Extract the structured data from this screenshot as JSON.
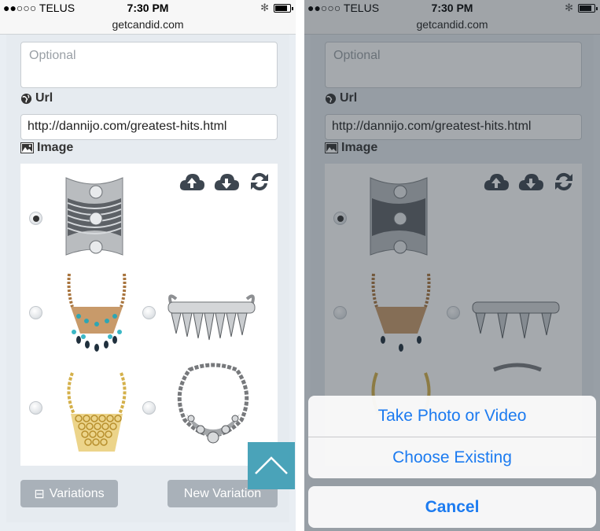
{
  "status": {
    "carrier": "●●○○○ TELUS",
    "time": "7:30 PM",
    "bluetooth": "✻",
    "domain": "getcandid.com"
  },
  "form": {
    "notes_placeholder": "Optional",
    "url_label": "Url",
    "url_value": "http://dannijo.com/greatest-hits.html",
    "image_label": "Image",
    "image_options": [
      {
        "name": "silver cuff bracelet",
        "selected": true
      },
      {
        "name": "turquoise bib necklace",
        "selected": false
      },
      {
        "name": "crystal cuff bracelet",
        "selected": false
      },
      {
        "name": "gold bib necklace",
        "selected": false
      },
      {
        "name": "crystal statement necklace",
        "selected": false
      }
    ],
    "tool_icons": [
      "cloud-upload-icon",
      "cloud-download-icon",
      "refresh-icon"
    ]
  },
  "buttons": {
    "variations": "Variations",
    "variations_icon": "⊟",
    "new_variation": "New Variation"
  },
  "action_sheet": {
    "take_photo": "Take Photo or Video",
    "choose_existing": "Choose Existing",
    "cancel": "Cancel"
  },
  "colors": {
    "accent": "#4aa3b9",
    "ios_blue": "#1c7bf0",
    "button_gray": "#a9b1b9"
  }
}
